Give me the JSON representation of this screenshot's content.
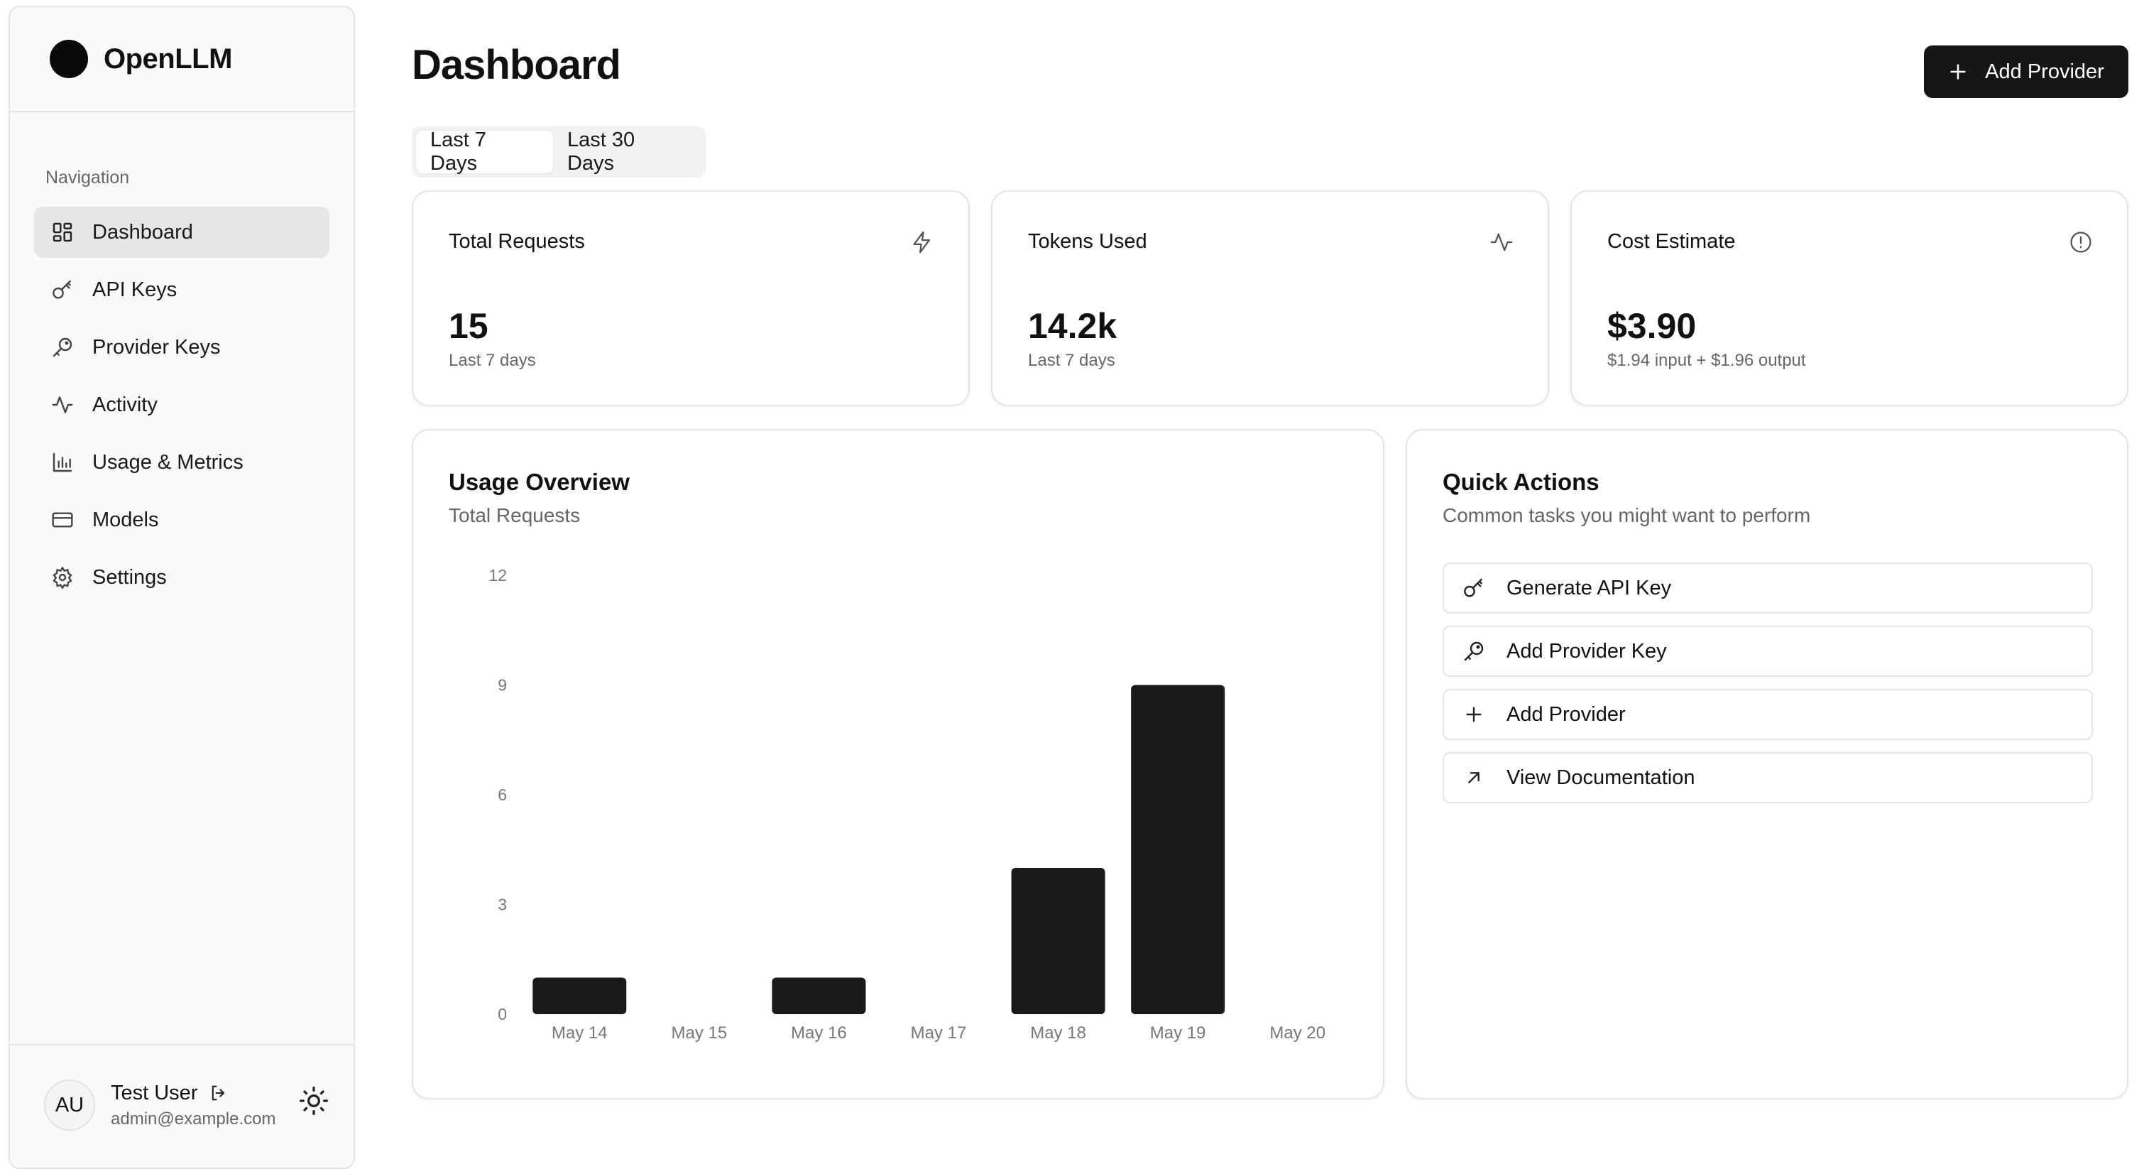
{
  "app": {
    "name": "OpenLLM"
  },
  "sidebar": {
    "section_title": "Navigation",
    "items": [
      {
        "label": "Dashboard",
        "icon": "dashboard-icon"
      },
      {
        "label": "API Keys",
        "icon": "key-icon"
      },
      {
        "label": "Provider Keys",
        "icon": "key-round-icon"
      },
      {
        "label": "Activity",
        "icon": "activity-icon"
      },
      {
        "label": "Usage & Metrics",
        "icon": "bar-chart-icon"
      },
      {
        "label": "Models",
        "icon": "card-icon"
      },
      {
        "label": "Settings",
        "icon": "gear-icon"
      }
    ],
    "user": {
      "initials": "AU",
      "name": "Test User",
      "email": "admin@example.com"
    }
  },
  "header": {
    "title": "Dashboard",
    "add_provider_label": "Add Provider"
  },
  "tabs": [
    {
      "label": "Last 7 Days",
      "active": true
    },
    {
      "label": "Last 30 Days",
      "active": false
    }
  ],
  "stats": [
    {
      "label": "Total Requests",
      "value": "15",
      "sub": "Last 7 days",
      "icon": "zap-icon"
    },
    {
      "label": "Tokens Used",
      "value": "14.2k",
      "sub": "Last 7 days",
      "icon": "activity-icon"
    },
    {
      "label": "Cost Estimate",
      "value": "$3.90",
      "sub": "$1.94 input + $1.96 output",
      "icon": "info-icon"
    }
  ],
  "usage": {
    "title": "Usage Overview",
    "subtitle": "Total Requests"
  },
  "chart_data": {
    "type": "bar",
    "categories": [
      "May 14",
      "May 15",
      "May 16",
      "May 17",
      "May 18",
      "May 19",
      "May 20"
    ],
    "values": [
      1,
      0,
      1,
      0,
      4,
      9,
      0
    ],
    "yticks": [
      0,
      3,
      6,
      9,
      12
    ],
    "ylim": [
      0,
      12
    ],
    "grid": false,
    "bar_color": "#1a1a1a"
  },
  "quick_actions": {
    "title": "Quick Actions",
    "subtitle": "Common tasks you might want to perform",
    "items": [
      {
        "label": "Generate API Key",
        "icon": "key-icon"
      },
      {
        "label": "Add Provider Key",
        "icon": "key-round-icon"
      },
      {
        "label": "Add Provider",
        "icon": "plus-icon"
      },
      {
        "label": "View Documentation",
        "icon": "arrow-up-right-icon"
      }
    ]
  },
  "colors": {
    "accent": "#161616",
    "active_nav": "#e6e6e6",
    "border": "#e5e5e5",
    "muted_text": "#666666"
  }
}
